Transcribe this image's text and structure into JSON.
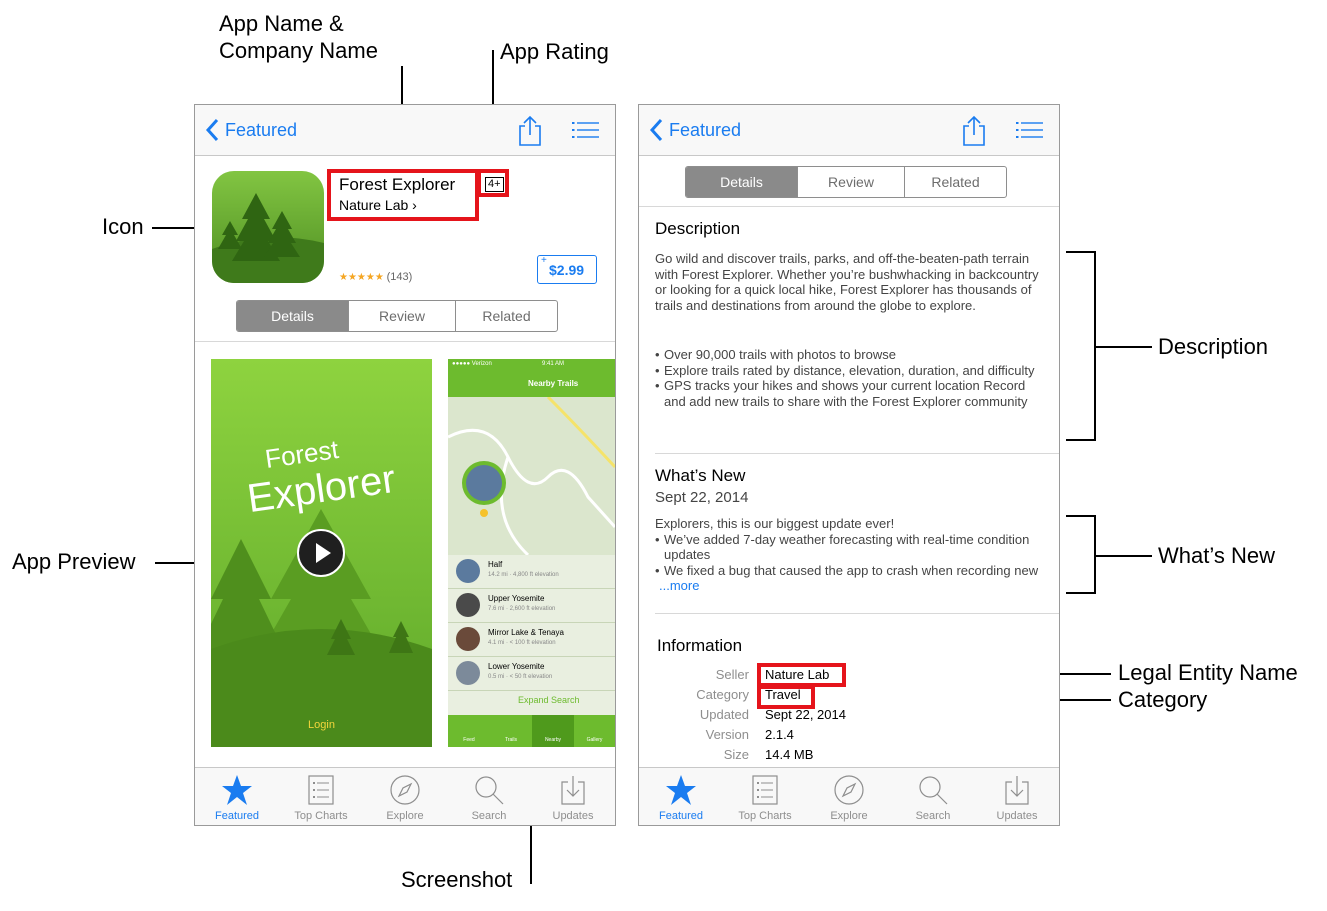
{
  "callouts": {
    "app_name_company_1": "App Name &",
    "app_name_company_2": "Company Name",
    "app_rating": "App Rating",
    "icon": "Icon",
    "app_preview": "App Preview",
    "screenshot": "Screenshot",
    "description": "Description",
    "whats_new": "What’s New",
    "legal_entity_name": "Legal Entity Name",
    "category": "Category"
  },
  "nav": {
    "back_label": "Featured"
  },
  "app": {
    "name": "Forest Explorer",
    "age_rating": "4+",
    "company": "Nature Lab",
    "stars": "★★★★★",
    "rating_count": "(143)",
    "price": "$2.99",
    "price_plus": "+"
  },
  "segments": [
    "Details",
    "Review",
    "Related"
  ],
  "preview": {
    "title_1": "Forest",
    "title_2": "Explorer",
    "login": "Login"
  },
  "screenshot": {
    "carrier": "●●●●● Verizon",
    "time": "9:41 AM",
    "title": "Nearby Trails",
    "trails": [
      {
        "name": "Half",
        "meta": "14.2 mi · 4,800 ft elevation"
      },
      {
        "name": "Upper Yosemite",
        "meta": "7.6 mi · 2,600 ft elevation"
      },
      {
        "name": "Mirror Lake & Tenaya",
        "meta": "4.1 mi · < 100 ft elevation"
      },
      {
        "name": "Lower Yosemite",
        "meta": "0.5 mi · < 50 ft elevation"
      }
    ],
    "expand": "Expand Search",
    "tabs": [
      "Feed",
      "Trails",
      "Nearby",
      "Gallery"
    ]
  },
  "details": {
    "description_title": "Description",
    "description_text": "Go wild and discover trails, parks, and off-the-beaten-path terrain with Forest Explorer. Whether you’re bushwhacking in backcountry or looking for a quick local hike, Forest Explorer has thousands of trails and destinations from around the globe to explore.",
    "bullets": [
      "Over 90,000 trails with photos to browse",
      "Explore trails rated by distance, elevation, duration, and difficulty",
      "GPS tracks your hikes and shows your current location Record and add new trails to share with the Forest Explorer community"
    ],
    "whats_new_title": "What’s New",
    "whats_new_date": "Sept 22, 2014",
    "whats_new_intro": "Explorers, this is our biggest update ever!",
    "whats_new_bullets": [
      "We’ve added 7-day weather forecasting with real-time condition updates",
      "We fixed a bug that caused the app to crash when recording new"
    ],
    "more": "...more",
    "information_title": "Information",
    "info": [
      {
        "key": "Seller",
        "value": "Nature Lab"
      },
      {
        "key": "Category",
        "value": "Travel"
      },
      {
        "key": "Updated",
        "value": "Sept 22, 2014"
      },
      {
        "key": "Version",
        "value": "2.1.4"
      },
      {
        "key": "Size",
        "value": "14.4 MB"
      }
    ]
  },
  "tabbar": [
    "Featured",
    "Top Charts",
    "Explore",
    "Search",
    "Updates"
  ],
  "colors": {
    "accent": "#1a7cf0",
    "highlight": "#e5141b",
    "green": "#6dbb2e"
  }
}
